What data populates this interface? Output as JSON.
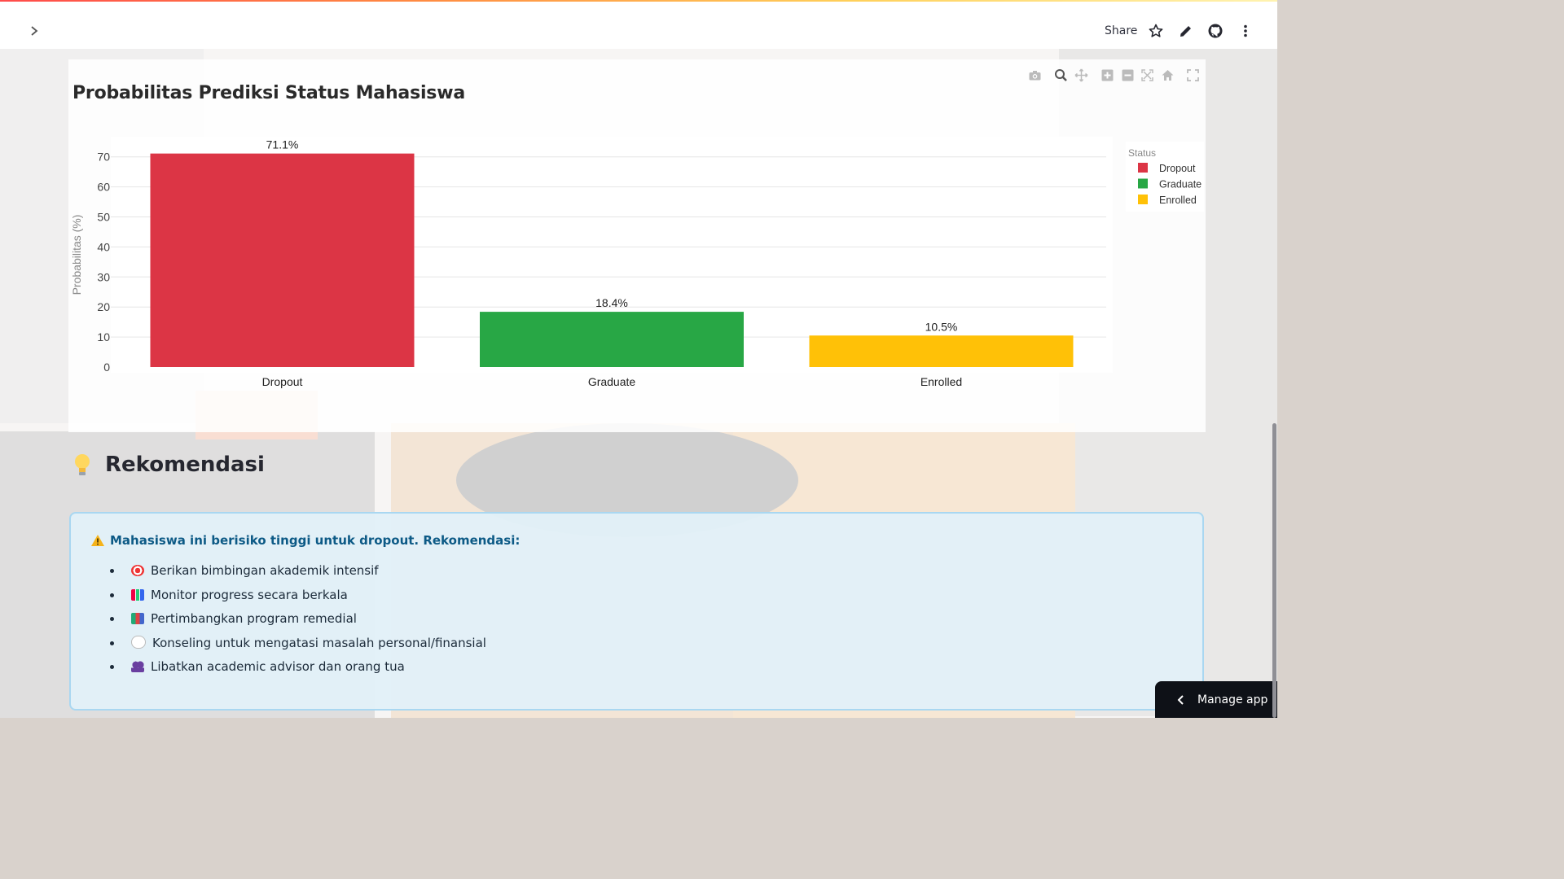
{
  "header": {
    "share_label": "Share",
    "icons": [
      "chevron-right-icon",
      "star-icon",
      "pencil-icon",
      "github-icon",
      "more-vert-icon"
    ]
  },
  "chart": {
    "title": "Probabilitas Prediksi Status Mahasiswa",
    "modebar_icons": [
      "camera-icon",
      "zoom-icon",
      "pan-icon",
      "zoom-in-icon",
      "zoom-out-icon",
      "autoscale-icon",
      "reset-axes-icon",
      "fullscreen-icon"
    ]
  },
  "chart_data": {
    "type": "bar",
    "title": "Probabilitas Prediksi Status Mahasiswa",
    "xlabel": "",
    "ylabel": "Probabilitas (%)",
    "categories": [
      "Dropout",
      "Graduate",
      "Enrolled"
    ],
    "values": [
      71.1,
      18.4,
      10.5
    ],
    "data_labels": [
      "71.1%",
      "18.4%",
      "10.5%"
    ],
    "colors": [
      "#dc3545",
      "#28a745",
      "#ffc107"
    ],
    "yticks": [
      0,
      10,
      20,
      30,
      40,
      50,
      60,
      70
    ],
    "ylim": [
      0,
      74.8
    ],
    "grid": true,
    "legend": {
      "title": "Status",
      "placement": "top-right",
      "entries": [
        "Dropout",
        "Graduate",
        "Enrolled"
      ]
    }
  },
  "recommendation": {
    "title": "Rekomendasi",
    "alert_text": "Mahasiswa ini berisiko tinggi untuk dropout. Rekomendasi:",
    "items": [
      {
        "text": "Berikan bimbingan akademik intensif",
        "icon": "target-icon"
      },
      {
        "text": "Monitor progress secara berkala",
        "icon": "bar-chart-icon"
      },
      {
        "text": "Pertimbangkan program remedial",
        "icon": "books-icon"
      },
      {
        "text": "Konseling untuk mengatasi masalah personal/finansial",
        "icon": "speech-bubble-icon"
      },
      {
        "text": "Libatkan academic advisor dan orang tua",
        "icon": "people-icon"
      }
    ]
  },
  "footer": {
    "manage_label": "Manage app"
  }
}
